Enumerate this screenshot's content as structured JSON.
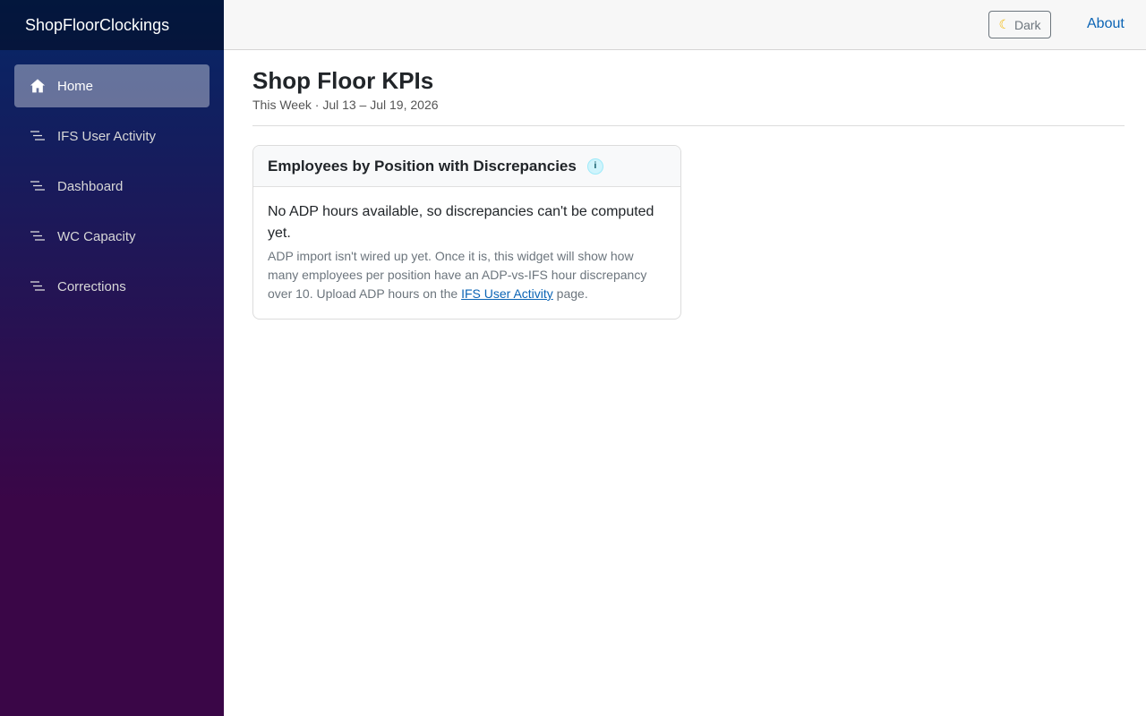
{
  "app": {
    "brand": "ShopFloorClockings"
  },
  "sidebar": {
    "items": [
      {
        "label": "Home",
        "icon": "home-icon",
        "active": true
      },
      {
        "label": "IFS User Activity",
        "icon": "list-icon"
      },
      {
        "label": "Dashboard",
        "icon": "list-icon"
      },
      {
        "label": "WC Capacity",
        "icon": "list-icon"
      },
      {
        "label": "Corrections",
        "icon": "list-icon"
      }
    ]
  },
  "topbar": {
    "theme_icon": "moon-icon",
    "theme_label": "Dark",
    "about_label": "About"
  },
  "page": {
    "title": "Shop Floor KPIs",
    "subtitle": "This Week · Jul 13 – Jul 19, 2026"
  },
  "card": {
    "title": "Employees by Position with Discrepancies",
    "info_icon_label": "i",
    "message": "No ADP hours available, so discrepancies can't be computed yet.",
    "detail_before": "ADP import isn't wired up yet. Once it is, this widget will show how many employees per position have an ADP-vs-IFS hour discrepancy over 10. Upload ADP hours on the ",
    "detail_link": "IFS User Activity",
    "detail_after": " page."
  },
  "colors": {
    "sidebar_top": "#052767",
    "sidebar_bottom": "#3a0647",
    "link": "#0b64b5",
    "info_badge": "#cff4fc"
  }
}
